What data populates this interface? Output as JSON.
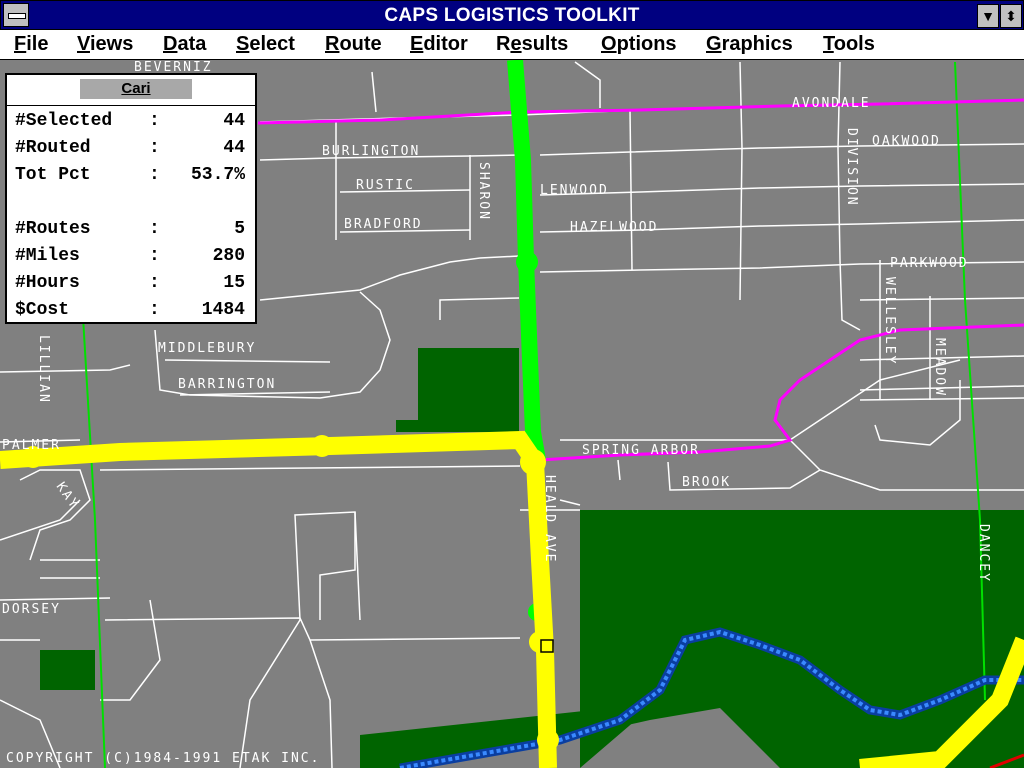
{
  "window": {
    "title": "CAPS LOGISTICS TOOLKIT",
    "sys_glyph": "▬",
    "minimize_glyph": "▼",
    "restore_glyph": "⬍"
  },
  "menu": [
    "File",
    "Views",
    "Data",
    "Select",
    "Route",
    "Editor",
    "Results",
    "Options",
    "Graphics",
    "Tools"
  ],
  "stats_panel": {
    "title": "Cari",
    "rows": [
      {
        "label": "#Selected",
        "sep": ":",
        "value": "44"
      },
      {
        "label": "#Routed",
        "sep": ":",
        "value": "44"
      },
      {
        "label": "Tot Pct",
        "sep": ":",
        "value": "53.7%"
      },
      {
        "label": "#Routes",
        "sep": ":",
        "value": "5"
      },
      {
        "label": "#Miles",
        "sep": ":",
        "value": "280"
      },
      {
        "label": "#Hours",
        "sep": ":",
        "value": "15"
      },
      {
        "label": "$Cost",
        "sep": ":",
        "value": "1484"
      }
    ]
  },
  "map": {
    "street_labels": {
      "beverly": "BEVERNIZ",
      "avondale": "AVONDALE",
      "oakwood": "OAKWOOD",
      "burlington": "BURLINGTON",
      "rustic": "RUSTIC",
      "bradford": "BRADFORD",
      "sharon": "SHARON",
      "glenwood": "LENWOOD",
      "hazelwood": "HAZELWOOD",
      "division": "DIVISION",
      "parkwood": "PARKWOOD",
      "wellesley": "WELLESLEY",
      "meadow": "MEADOW",
      "middlebury": "MIDDLEBURY",
      "barrington": "BARRINGTON",
      "palmer": "PALMER",
      "spring_arbor": "SPRING ARBOR",
      "brook": "BROOK",
      "lillian": "LILLIAN",
      "kay": "KAY",
      "heald_ave": "HEALD AVE",
      "dorsey": "DORSEY",
      "dancey": "DANCEY"
    },
    "copyright": "COPYRIGHT (C)1984-1991 ETAK INC."
  },
  "colors": {
    "titlebar": "#000080",
    "map_background": "#808080",
    "park": "#006400",
    "route_green": "#00ff00",
    "route_yellow": "#ffff00",
    "boundary_magenta": "#ff00ff",
    "river_blue": "#2080ff",
    "street": "#ffffff",
    "boundary_green": "#00e000"
  }
}
